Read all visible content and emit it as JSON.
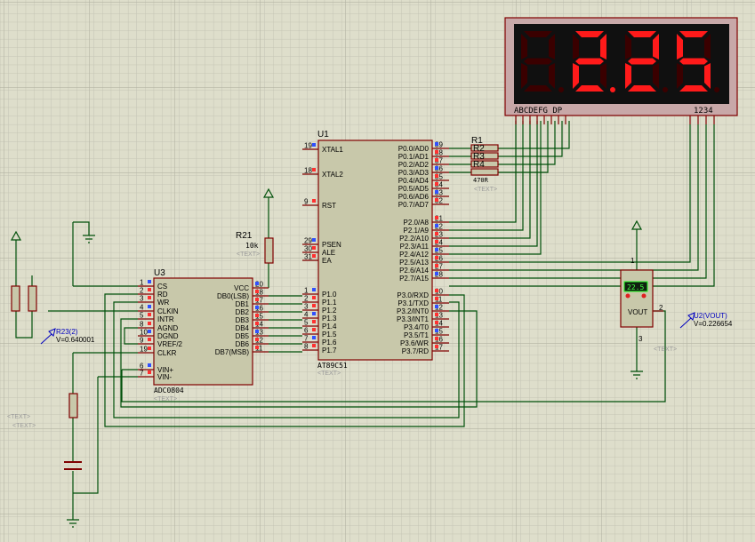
{
  "colors": {
    "background": "#dedecb",
    "wire": "#00500a",
    "pin": "#800000",
    "body": "#c8c8aa",
    "segment_on": "#ff1a1a",
    "segment_off": "#3a0000",
    "probe": "#0000c0",
    "pin_high": "#ff3030",
    "pin_low": "#3050ff"
  },
  "u1": {
    "ref": "U1",
    "part": "AT89C51",
    "text": "<TEXT>",
    "left_pins": [
      [
        "19",
        "XTAL1"
      ],
      [
        "18",
        "XTAL2"
      ],
      [
        "9",
        "RST"
      ],
      [
        "29",
        "PSEN"
      ],
      [
        "30",
        "ALE"
      ],
      [
        "31",
        "EA"
      ],
      [
        "1",
        "P1.0"
      ],
      [
        "2",
        "P1.1"
      ],
      [
        "3",
        "P1.2"
      ],
      [
        "4",
        "P1.3"
      ],
      [
        "5",
        "P1.4"
      ],
      [
        "6",
        "P1.5"
      ],
      [
        "7",
        "P1.6"
      ],
      [
        "8",
        "P1.7"
      ]
    ],
    "right_pins": [
      [
        "39",
        "P0.0/AD0"
      ],
      [
        "38",
        "P0.1/AD1"
      ],
      [
        "37",
        "P0.2/AD2"
      ],
      [
        "36",
        "P0.3/AD3"
      ],
      [
        "35",
        "P0.4/AD4"
      ],
      [
        "34",
        "P0.5/AD5"
      ],
      [
        "33",
        "P0.6/AD6"
      ],
      [
        "32",
        "P0.7/AD7"
      ],
      [
        "21",
        "P2.0/A8"
      ],
      [
        "22",
        "P2.1/A9"
      ],
      [
        "23",
        "P2.2/A10"
      ],
      [
        "24",
        "P2.3/A11"
      ],
      [
        "25",
        "P2.4/A12"
      ],
      [
        "26",
        "P2.5/A13"
      ],
      [
        "27",
        "P2.6/A14"
      ],
      [
        "28",
        "P2.7/A15"
      ],
      [
        "10",
        "P3.0/RXD"
      ],
      [
        "11",
        "P3.1/TXD"
      ],
      [
        "12",
        "P3.2/INT0"
      ],
      [
        "13",
        "P3.3/INT1"
      ],
      [
        "14",
        "P3.4/T0"
      ],
      [
        "15",
        "P3.5/T1"
      ],
      [
        "16",
        "P3.6/WR"
      ],
      [
        "17",
        "P3.7/RD"
      ]
    ]
  },
  "u3": {
    "ref": "U3",
    "part": "ADC0804",
    "text": "<TEXT>",
    "left_pins": [
      [
        "1",
        "CS"
      ],
      [
        "2",
        "RD"
      ],
      [
        "3",
        "WR"
      ],
      [
        "4",
        "CLKIN"
      ],
      [
        "5",
        "INTR"
      ],
      [
        "8",
        "AGND"
      ],
      [
        "10",
        "DGND"
      ],
      [
        "9",
        "VREF/2"
      ],
      [
        "19",
        "CLKR"
      ],
      [
        "6",
        "VIN+"
      ],
      [
        "7",
        "VIN-"
      ]
    ],
    "right_pins": [
      [
        "20",
        "VCC"
      ],
      [
        "18",
        "DB0(LSB)"
      ],
      [
        "17",
        "DB1"
      ],
      [
        "16",
        "DB2"
      ],
      [
        "15",
        "DB3"
      ],
      [
        "14",
        "DB4"
      ],
      [
        "13",
        "DB5"
      ],
      [
        "12",
        "DB6"
      ],
      [
        "11",
        "DB7(MSB)"
      ]
    ]
  },
  "r21": {
    "ref": "R21",
    "value": "10k",
    "text": "<TEXT>"
  },
  "r1": {
    "ref": "R1",
    "rows": [
      "R2",
      "R3",
      "R4"
    ],
    "value": "470R",
    "text": "<TEXT>"
  },
  "display": {
    "digits": [
      "8",
      "2",
      "2",
      "5"
    ],
    "lit": [
      false,
      true,
      true,
      true
    ],
    "dp_after_digit": 2,
    "segment_label": "ABCDEFG  DP",
    "digit_label": "1234"
  },
  "u2": {
    "lcd": "22.5",
    "pin_label": "VOUT",
    "pin1": "1",
    "pin2": "2",
    "pin3": "3",
    "text": "<TEXT>"
  },
  "probes": [
    {
      "name": "R23(2)",
      "value": "V=0.640001"
    },
    {
      "name": "U2(VOUT)",
      "value": "V=0.226654"
    }
  ],
  "free_text": [
    "<TEXT>",
    "<TEXT>"
  ]
}
